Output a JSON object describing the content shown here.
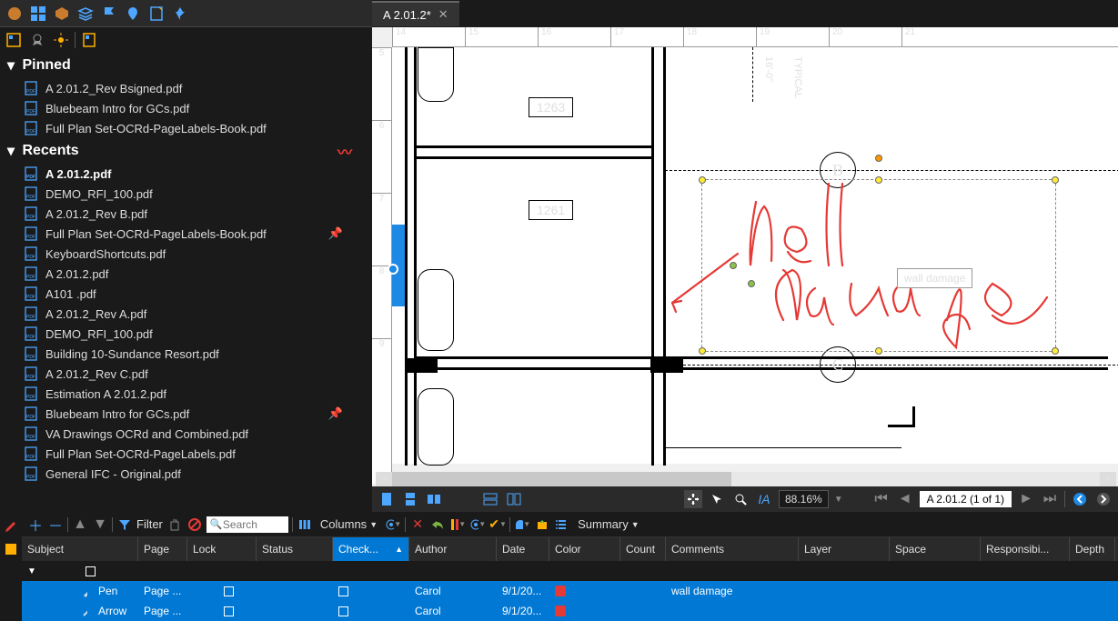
{
  "tab": {
    "title": "A 2.01.2*"
  },
  "sidebar": {
    "pinned_label": "Pinned",
    "recents_label": "Recents",
    "pinned": [
      {
        "name": "A 2.01.2_Rev Bsigned.pdf"
      },
      {
        "name": "Bluebeam Intro for GCs.pdf"
      },
      {
        "name": "Full Plan Set-OCRd-PageLabels-Book.pdf"
      }
    ],
    "recents": [
      {
        "name": "A 2.01.2.pdf",
        "selected": true
      },
      {
        "name": "DEMO_RFI_100.pdf"
      },
      {
        "name": "A 2.01.2_Rev B.pdf"
      },
      {
        "name": "Full Plan Set-OCRd-PageLabels-Book.pdf",
        "pinned": true
      },
      {
        "name": "KeyboardShortcuts.pdf"
      },
      {
        "name": "A 2.01.2.pdf"
      },
      {
        "name": "A101 .pdf"
      },
      {
        "name": "A 2.01.2_Rev A.pdf"
      },
      {
        "name": "DEMO_RFI_100.pdf"
      },
      {
        "name": "Building 10-Sundance Resort.pdf"
      },
      {
        "name": "A 2.01.2_Rev C.pdf"
      },
      {
        "name": "Estimation A 2.01.2.pdf"
      },
      {
        "name": "Bluebeam Intro for GCs.pdf",
        "pinned": true
      },
      {
        "name": "VA Drawings OCRd and Combined.pdf"
      },
      {
        "name": "Full Plan Set-OCRd-PageLabels.pdf"
      },
      {
        "name": "General IFC - Original.pdf"
      }
    ]
  },
  "ruler_h": [
    "14",
    "15",
    "16",
    "17",
    "18",
    "19",
    "20",
    "21"
  ],
  "ruler_v": [
    "5",
    "6",
    "7",
    "8",
    "9"
  ],
  "drawing": {
    "room1": "1263",
    "room2": "1261",
    "gridB": "B",
    "gridC": "C",
    "dim1": "16'-0\"",
    "dim2": "TYPICAL",
    "tooltip": "wall damage"
  },
  "bottombar": {
    "zoom": "88.16%",
    "page": "A 2.01.2 (1 of 1)"
  },
  "markup": {
    "filter_label": "Filter",
    "search_placeholder": "Search",
    "columns_label": "Columns",
    "summary_label": "Summary",
    "headers": {
      "subject": "Subject",
      "page": "Page",
      "lock": "Lock",
      "status": "Status",
      "check": "Check...",
      "author": "Author",
      "date": "Date",
      "color": "Color",
      "count": "Count",
      "comments": "Comments",
      "layer": "Layer",
      "space": "Space",
      "resp": "Responsibi...",
      "depth": "Depth"
    },
    "rows": [
      {
        "icon": "pen",
        "subject": "Pen",
        "page": "Page ...",
        "author": "Carol",
        "date": "9/1/20...",
        "comments": "wall damage"
      },
      {
        "icon": "arrow",
        "subject": "Arrow",
        "page": "Page ...",
        "author": "Carol",
        "date": "9/1/20...",
        "comments": ""
      }
    ]
  }
}
